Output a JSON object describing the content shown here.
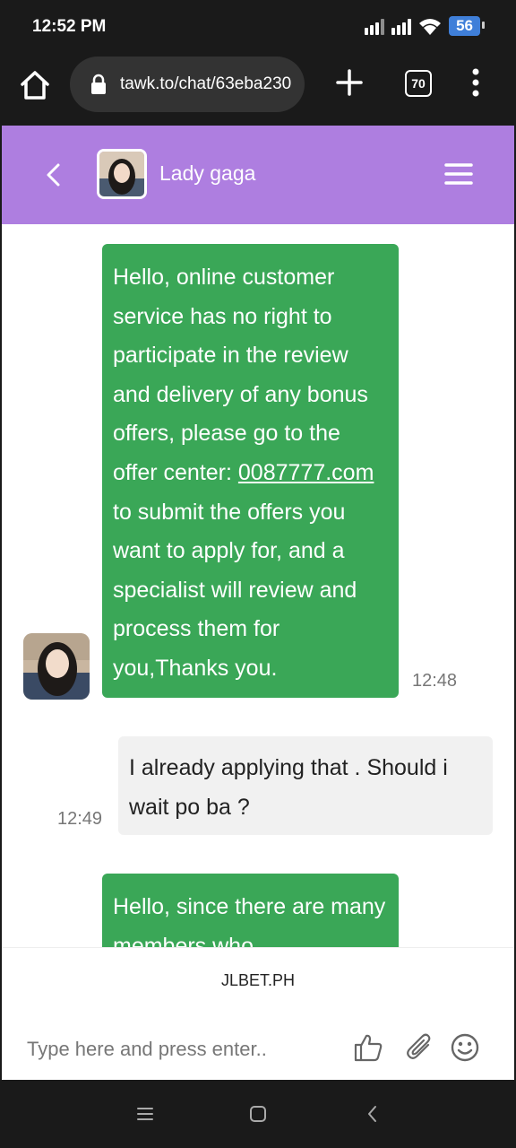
{
  "status_bar": {
    "time": "12:52 PM",
    "battery": "56"
  },
  "browser": {
    "url": "tawk.to/chat/63eba230",
    "tab_count": "70"
  },
  "chat_header": {
    "agent_name": "Lady gaga"
  },
  "messages": [
    {
      "from": "agent",
      "text_before_link": "Hello, online customer service has no right to participate in the review and delivery of any bonus offers, please go to the offer center: ",
      "link": "0087777.com",
      "text_after_link": " to submit the offers you want to apply for, and a specialist will review and process them for you,Thanks you.",
      "time": "12:48"
    },
    {
      "from": "user",
      "text": "I already applying that . Should i wait po ba ?",
      "time": "12:49"
    },
    {
      "from": "agent",
      "text": "Hello, since there are many members who"
    }
  ],
  "footer": {
    "brand": "JLBET.PH",
    "composer_placeholder": "Type here and press enter.."
  },
  "colors": {
    "header_bg": "#ae7ee0",
    "agent_bubble": "#3aa757",
    "user_bubble": "#f1f1f1",
    "battery": "#3f7fd9"
  }
}
